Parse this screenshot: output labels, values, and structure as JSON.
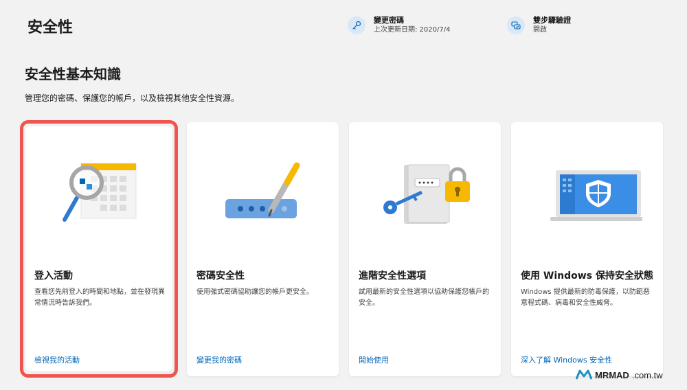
{
  "header": {
    "title": "安全性",
    "change_password": {
      "title": "變更密碼",
      "subtitle": "上次更新日期: 2020/7/4"
    },
    "two_step": {
      "title": "雙步驟驗證",
      "subtitle": "開啟"
    }
  },
  "section": {
    "title": "安全性基本知識",
    "description": "管理您的密碼、保護您的帳戶，以及檢視其他安全性資源。"
  },
  "cards": [
    {
      "title": "登入活動",
      "description": "查看您先前登入的時間和地點，並在發現異常情況時告訴我們。",
      "link": "檢視我的活動"
    },
    {
      "title": "密碼安全性",
      "description": "使用強式密碼協助讓您的帳戶更安全。",
      "link": "變更我的密碼"
    },
    {
      "title": "進階安全性選項",
      "description": "試用最新的安全性選項以協助保護您帳戶的安全。",
      "link": "開始使用"
    },
    {
      "title": "使用 Windows 保持安全狀態",
      "description": "Windows 提供最新的防毒保護，以防範惡意程式碼、病毒和安全性威脅。",
      "link": "深入了解 Windows 安全性"
    }
  ],
  "watermark": {
    "brand": "MRMAD",
    "suffix": ".com.tw"
  },
  "colors": {
    "accent": "#0067b8",
    "highlight": "#f0544f",
    "background": "#f2f2f2"
  }
}
